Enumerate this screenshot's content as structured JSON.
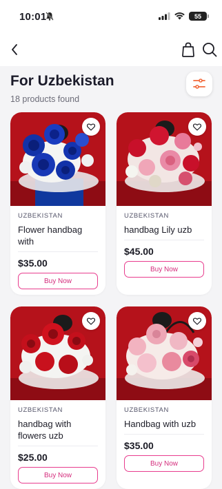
{
  "status_bar": {
    "time": "10:01",
    "battery": "55"
  },
  "header": {
    "title": "For Uzbekistan",
    "subtitle": "18 products found"
  },
  "buy_label": "Buy Now",
  "products": [
    {
      "brand": "UZBEKISTAN",
      "name": "Flower handbag with",
      "price": "$35.00",
      "palette": "blue"
    },
    {
      "brand": "UZBEKISTAN",
      "name": "handbag Lily uzb",
      "price": "$45.00",
      "palette": "mixed"
    },
    {
      "brand": "UZBEKISTAN",
      "name": "handbag with flowers uzb",
      "price": "$25.00",
      "palette": "red"
    },
    {
      "brand": "UZBEKISTAN",
      "name": "Handbag with uzb",
      "price": "$35.00",
      "palette": "pink"
    }
  ],
  "colors": {
    "accent": "#e83b8d",
    "filter_icon": "#f26a3c",
    "card_bg": "#ffffff",
    "page_bg": "#f4f4f6",
    "photo_bg": "#b5121b"
  }
}
